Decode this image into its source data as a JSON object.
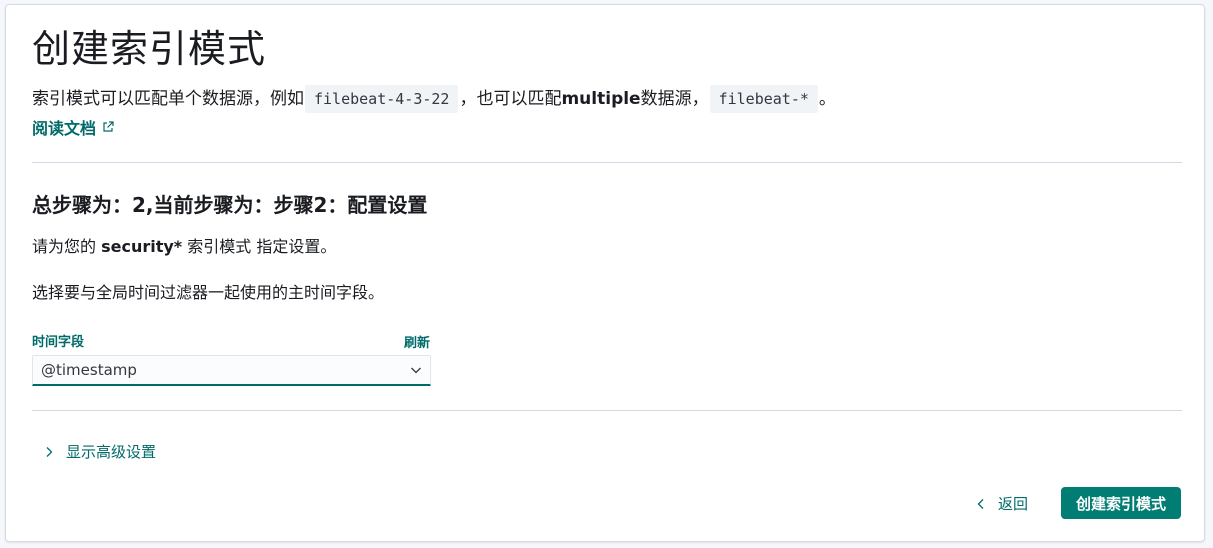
{
  "page": {
    "title": "创建索引模式",
    "description": {
      "part1": "索引模式可以匹配单个数据源，例如",
      "code1": "filebeat-4-3-22",
      "part2": "，也可以匹配",
      "bold": "multiple",
      "part3": "数据源，",
      "code2": "filebeat-*",
      "part4": "。"
    },
    "doc_link": "阅读文档"
  },
  "step": {
    "title": "总步骤为：2,当前步骤为：步骤2：配置设置",
    "instruction_prefix": "请为您的 ",
    "pattern_name": "security*",
    "instruction_suffix": " 索引模式 指定设置。",
    "timefield_help": "选择要与全局时间过滤器一起使用的主时间字段。"
  },
  "time_field": {
    "label": "时间字段",
    "refresh_label": "刷新",
    "selected": "@timestamp"
  },
  "advanced": {
    "label": "显示高级设置"
  },
  "footer": {
    "back_label": "返回",
    "create_label": "创建索引模式"
  },
  "colors": {
    "accent": "#006b69",
    "primary_button": "#017d73",
    "border": "#d3dae6"
  }
}
